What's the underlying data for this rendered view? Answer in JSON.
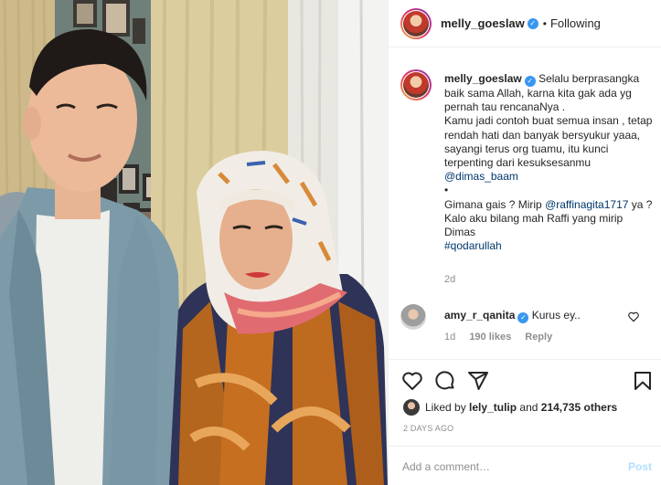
{
  "header": {
    "username": "melly_goeslaw",
    "separator": "•",
    "follow_status": "Following"
  },
  "caption": {
    "username": "melly_goeslaw",
    "text_1": "Selalu berprasangka baik sama Allah, karna kita gak ada yg pernah tau rencanaNya .",
    "text_2": "Kamu jadi contoh buat semua insan , tetap rendah hati dan banyak bersyukur yaaa, sayangi terus org tuamu, itu kunci terpenting dari kesuksesanmu",
    "mention_1": "@dimas_baam",
    "bullet": "•",
    "text_3": "Gimana gais ? Mirip",
    "mention_2": "@raffinagita1717",
    "text_4": "ya ? Kalo aku bilang mah Raffi yang mirip Dimas",
    "hashtag": "#qodarullah",
    "age": "2d"
  },
  "comment": {
    "username": "amy_r_qanita",
    "text": "Kurus ey..",
    "time": "1d",
    "likes": "190 likes",
    "reply": "Reply"
  },
  "actions": {
    "icons": [
      "heart-icon",
      "comment-icon",
      "share-icon",
      "bookmark-icon"
    ]
  },
  "likes": {
    "prefix": "Liked by",
    "user": "lely_tulip",
    "middle": "and",
    "count": "214,735 others"
  },
  "date": "2 DAYS AGO",
  "add_comment": {
    "placeholder": "Add a comment…",
    "post": "Post"
  },
  "colors": {
    "link": "#00376b",
    "verified": "#3897f0",
    "muted": "#8e8e8e",
    "post_disabled": "#b2dffc"
  }
}
